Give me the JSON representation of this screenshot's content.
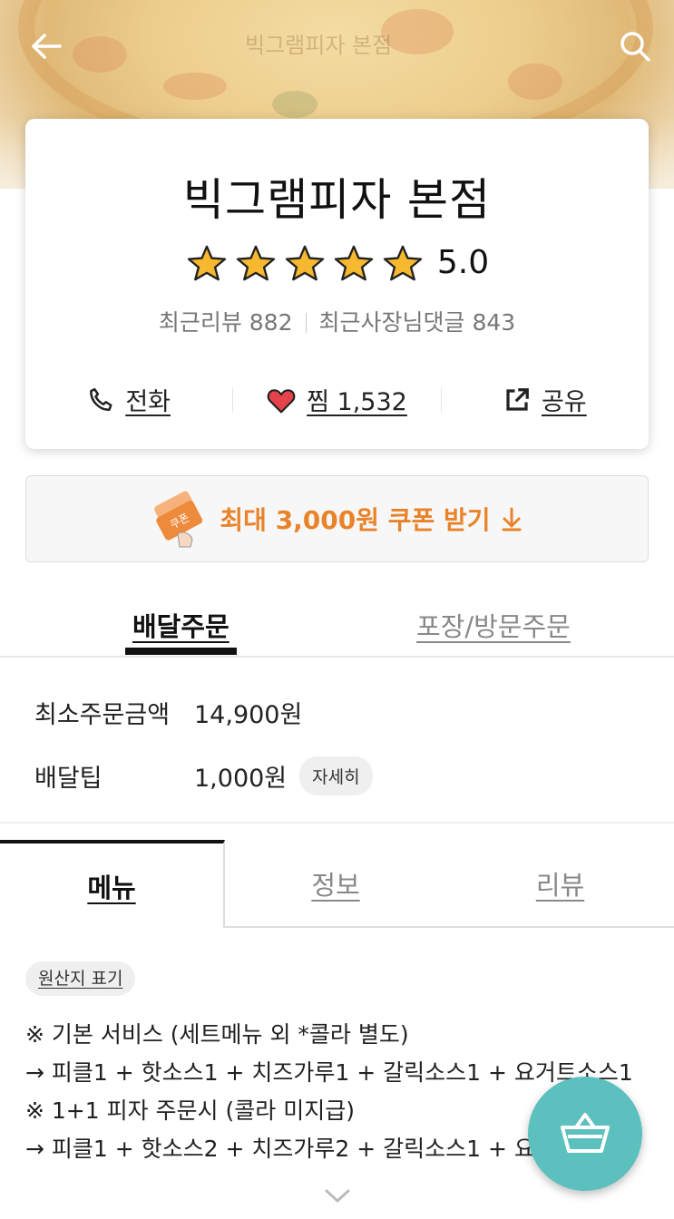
{
  "header": {
    "watermark": "빅그램피자 본점",
    "back_icon": "arrow-left-icon",
    "search_icon": "search-icon"
  },
  "store": {
    "name": "빅그램피자 본점",
    "rating": "5.0",
    "stars": 5,
    "recent_reviews": "최근리뷰 882",
    "owner_replies": "최근사장님댓글 843",
    "actions": {
      "call": "전화",
      "like": "찜 1,532",
      "share": "공유"
    }
  },
  "coupon": {
    "text": "최대 3,000원 쿠폰 받기",
    "badge": "쿠폰",
    "accent": "#e9832a"
  },
  "order_tabs": {
    "delivery": "배달주문",
    "pickup": "포장/방문주문"
  },
  "delivery_info": {
    "min_order_label": "최소주문금액",
    "min_order_value": "14,900원",
    "tip_label": "배달팁",
    "tip_value": "1,000원",
    "detail": "자세히"
  },
  "menu_tabs": {
    "menu": "메뉴",
    "info": "정보",
    "review": "리뷰"
  },
  "origin_label": "원산지 표기",
  "notes": [
    "※ 기본 서비스 (세트메뉴 외 *콜라 별도)",
    "→ 피클1 + 핫소스1 + 치즈가루1 + 갈릭소스1 + 요거트소스1",
    "※ 1+1 피자 주문시 (콜라 미지급)",
    "→ 피클1 + 핫소스2 + 치즈가루2 + 갈릭소스1 + 요거트소스2"
  ],
  "cart_icon": "basket-icon",
  "colors": {
    "fab": "#5bc0be",
    "star": "#f5b82e",
    "heart": "#e4434b"
  }
}
